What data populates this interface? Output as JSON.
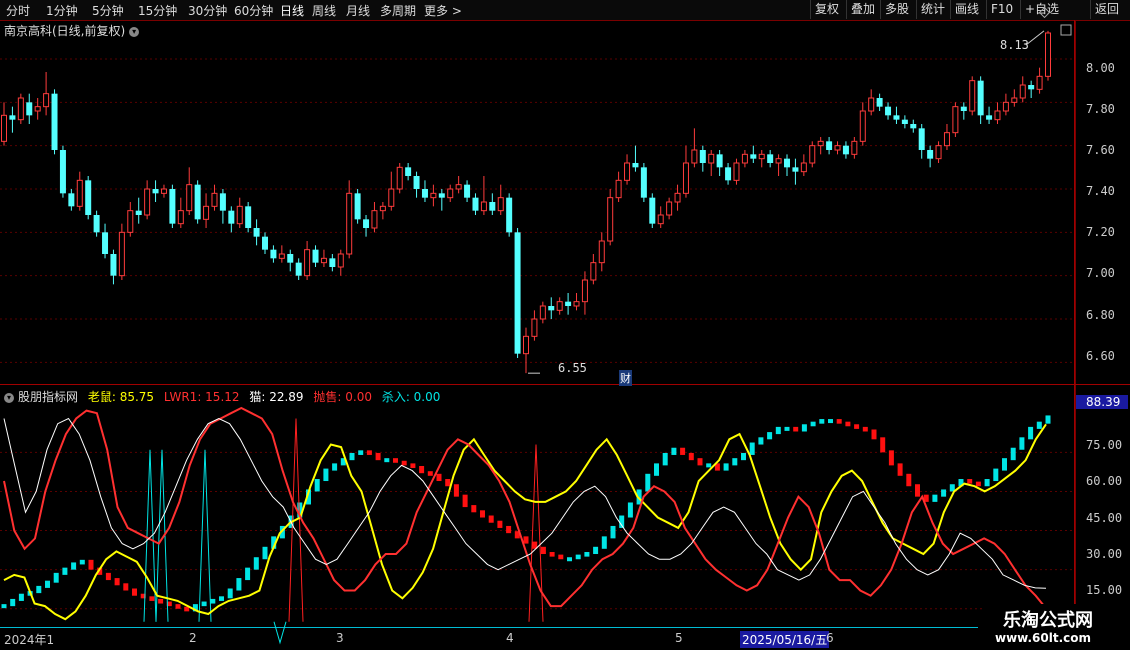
{
  "toolbar": {
    "timeframes": [
      "分时",
      "1分钟",
      "5分钟",
      "15分钟",
      "30分钟",
      "60分钟",
      "日线",
      "周线",
      "月线",
      "多周期",
      "更多 >"
    ],
    "active_timeframe": "日线",
    "right_buttons": [
      "复权",
      "叠加",
      "多股",
      "统计",
      "画线",
      "F10",
      "+自选",
      "返回"
    ]
  },
  "price_panel": {
    "title": "南京高科(日线,前复权)",
    "axis_ticks": [
      "8.00",
      "7.80",
      "7.60",
      "7.40",
      "7.20",
      "7.00",
      "6.80",
      "6.60"
    ],
    "high_marker": "8.13",
    "low_marker": "6.55",
    "finance_badge": "财",
    "ylim": [
      6.5,
      8.18
    ]
  },
  "indicator_panel": {
    "name": "股朋指标网",
    "labels": [
      {
        "text": "老鼠: 85.75",
        "color": "#ffff00"
      },
      {
        "text": "LWR1: 15.12",
        "color": "#ff3030"
      },
      {
        "text": "猫: 22.89",
        "color": "#ffffff"
      },
      {
        "text": "抛售: 0.00",
        "color": "#ff3030"
      },
      {
        "text": "杀入: 0.00",
        "color": "#00e5e5"
      }
    ],
    "axis_ticks": [
      "75.00",
      "60.00",
      "45.00",
      "30.00",
      "15.00"
    ],
    "current_value": "88.39",
    "ylim": [
      8,
      97
    ]
  },
  "time_axis": {
    "labels": [
      "2024年1",
      "2",
      "3",
      "4",
      "5",
      "2025/05/16/五",
      "6"
    ],
    "selected": "2025/05/16/五"
  },
  "watermark": {
    "line1": "乐淘公式网",
    "line2": "www.60lt.com"
  },
  "chart_data": [
    {
      "type": "candlestick",
      "title": "南京高科(日线,前复权)",
      "ylim": [
        6.5,
        8.18
      ],
      "candles": [
        [
          7.62,
          7.74,
          7.8,
          7.6
        ],
        [
          7.74,
          7.72,
          7.78,
          7.66
        ],
        [
          7.72,
          7.82,
          7.84,
          7.7
        ],
        [
          7.8,
          7.74,
          7.84,
          7.7
        ],
        [
          7.76,
          7.78,
          7.82,
          7.72
        ],
        [
          7.78,
          7.84,
          7.94,
          7.74
        ],
        [
          7.84,
          7.58,
          7.86,
          7.56
        ],
        [
          7.58,
          7.38,
          7.6,
          7.36
        ],
        [
          7.38,
          7.32,
          7.4,
          7.3
        ],
        [
          7.32,
          7.44,
          7.48,
          7.3
        ],
        [
          7.44,
          7.28,
          7.46,
          7.26
        ],
        [
          7.28,
          7.2,
          7.3,
          7.18
        ],
        [
          7.2,
          7.1,
          7.24,
          7.08
        ],
        [
          7.1,
          7.0,
          7.12,
          6.96
        ],
        [
          7.0,
          7.2,
          7.24,
          6.98
        ],
        [
          7.2,
          7.3,
          7.34,
          7.18
        ],
        [
          7.3,
          7.28,
          7.36,
          7.24
        ],
        [
          7.28,
          7.4,
          7.44,
          7.26
        ],
        [
          7.4,
          7.38,
          7.44,
          7.34
        ],
        [
          7.38,
          7.4,
          7.42,
          7.36
        ],
        [
          7.4,
          7.24,
          7.42,
          7.22
        ],
        [
          7.24,
          7.3,
          7.36,
          7.22
        ],
        [
          7.3,
          7.42,
          7.5,
          7.28
        ],
        [
          7.42,
          7.26,
          7.44,
          7.24
        ],
        [
          7.26,
          7.32,
          7.38,
          7.22
        ],
        [
          7.32,
          7.38,
          7.42,
          7.3
        ],
        [
          7.38,
          7.3,
          7.4,
          7.24
        ],
        [
          7.3,
          7.24,
          7.32,
          7.2
        ],
        [
          7.24,
          7.32,
          7.36,
          7.22
        ],
        [
          7.32,
          7.22,
          7.34,
          7.2
        ],
        [
          7.22,
          7.18,
          7.26,
          7.14
        ],
        [
          7.18,
          7.12,
          7.2,
          7.1
        ],
        [
          7.12,
          7.08,
          7.14,
          7.06
        ],
        [
          7.08,
          7.1,
          7.14,
          7.06
        ],
        [
          7.1,
          7.06,
          7.12,
          7.02
        ],
        [
          7.06,
          7.0,
          7.08,
          6.98
        ],
        [
          7.0,
          7.12,
          7.16,
          6.98
        ],
        [
          7.12,
          7.06,
          7.14,
          7.04
        ],
        [
          7.06,
          7.08,
          7.12,
          7.04
        ],
        [
          7.08,
          7.04,
          7.1,
          7.02
        ],
        [
          7.04,
          7.1,
          7.12,
          7.0
        ],
        [
          7.1,
          7.38,
          7.44,
          7.08
        ],
        [
          7.38,
          7.26,
          7.4,
          7.24
        ],
        [
          7.26,
          7.22,
          7.28,
          7.18
        ],
        [
          7.22,
          7.3,
          7.34,
          7.2
        ],
        [
          7.3,
          7.32,
          7.34,
          7.26
        ],
        [
          7.32,
          7.4,
          7.48,
          7.3
        ],
        [
          7.4,
          7.5,
          7.52,
          7.38
        ],
        [
          7.5,
          7.46,
          7.52,
          7.44
        ],
        [
          7.46,
          7.4,
          7.48,
          7.36
        ],
        [
          7.4,
          7.36,
          7.44,
          7.34
        ],
        [
          7.36,
          7.38,
          7.42,
          7.32
        ],
        [
          7.38,
          7.36,
          7.4,
          7.3
        ],
        [
          7.36,
          7.4,
          7.42,
          7.34
        ],
        [
          7.4,
          7.42,
          7.46,
          7.38
        ],
        [
          7.42,
          7.36,
          7.44,
          7.34
        ],
        [
          7.36,
          7.3,
          7.38,
          7.28
        ],
        [
          7.3,
          7.34,
          7.46,
          7.28
        ],
        [
          7.34,
          7.3,
          7.38,
          7.28
        ],
        [
          7.3,
          7.36,
          7.42,
          7.28
        ],
        [
          7.36,
          7.2,
          7.38,
          7.18
        ],
        [
          7.2,
          6.64,
          7.22,
          6.62
        ],
        [
          6.64,
          6.72,
          6.76,
          6.55
        ],
        [
          6.72,
          6.8,
          6.84,
          6.7
        ],
        [
          6.8,
          6.86,
          6.88,
          6.78
        ],
        [
          6.86,
          6.84,
          6.9,
          6.8
        ],
        [
          6.84,
          6.88,
          6.9,
          6.82
        ],
        [
          6.88,
          6.86,
          6.92,
          6.82
        ],
        [
          6.86,
          6.88,
          6.92,
          6.84
        ],
        [
          6.88,
          6.98,
          7.02,
          6.82
        ],
        [
          6.98,
          7.06,
          7.1,
          6.96
        ],
        [
          7.06,
          7.16,
          7.2,
          7.02
        ],
        [
          7.16,
          7.36,
          7.4,
          7.14
        ],
        [
          7.36,
          7.44,
          7.48,
          7.34
        ],
        [
          7.44,
          7.52,
          7.56,
          7.42
        ],
        [
          7.52,
          7.5,
          7.6,
          7.48
        ],
        [
          7.5,
          7.36,
          7.52,
          7.34
        ],
        [
          7.36,
          7.24,
          7.38,
          7.22
        ],
        [
          7.24,
          7.28,
          7.32,
          7.22
        ],
        [
          7.28,
          7.34,
          7.36,
          7.26
        ],
        [
          7.34,
          7.38,
          7.42,
          7.3
        ],
        [
          7.38,
          7.52,
          7.6,
          7.36
        ],
        [
          7.52,
          7.58,
          7.68,
          7.5
        ],
        [
          7.58,
          7.52,
          7.6,
          7.48
        ],
        [
          7.52,
          7.56,
          7.58,
          7.46
        ],
        [
          7.56,
          7.5,
          7.58,
          7.46
        ],
        [
          7.5,
          7.44,
          7.52,
          7.42
        ],
        [
          7.44,
          7.52,
          7.54,
          7.42
        ],
        [
          7.52,
          7.56,
          7.58,
          7.5
        ],
        [
          7.56,
          7.54,
          7.6,
          7.52
        ],
        [
          7.54,
          7.56,
          7.58,
          7.5
        ],
        [
          7.56,
          7.52,
          7.58,
          7.5
        ],
        [
          7.52,
          7.54,
          7.56,
          7.46
        ],
        [
          7.54,
          7.5,
          7.56,
          7.46
        ],
        [
          7.5,
          7.48,
          7.54,
          7.42
        ],
        [
          7.48,
          7.52,
          7.56,
          7.46
        ],
        [
          7.52,
          7.6,
          7.62,
          7.5
        ],
        [
          7.6,
          7.62,
          7.64,
          7.56
        ],
        [
          7.62,
          7.58,
          7.64,
          7.56
        ],
        [
          7.58,
          7.6,
          7.62,
          7.56
        ],
        [
          7.6,
          7.56,
          7.62,
          7.54
        ],
        [
          7.56,
          7.62,
          7.64,
          7.54
        ],
        [
          7.62,
          7.76,
          7.8,
          7.6
        ],
        [
          7.76,
          7.82,
          7.86,
          7.74
        ],
        [
          7.82,
          7.78,
          7.84,
          7.76
        ],
        [
          7.78,
          7.74,
          7.8,
          7.72
        ],
        [
          7.74,
          7.72,
          7.78,
          7.7
        ],
        [
          7.72,
          7.7,
          7.74,
          7.68
        ],
        [
          7.7,
          7.68,
          7.72,
          7.66
        ],
        [
          7.68,
          7.58,
          7.7,
          7.54
        ],
        [
          7.58,
          7.54,
          7.6,
          7.5
        ],
        [
          7.54,
          7.6,
          7.62,
          7.52
        ],
        [
          7.6,
          7.66,
          7.7,
          7.58
        ],
        [
          7.66,
          7.78,
          7.8,
          7.64
        ],
        [
          7.78,
          7.76,
          7.8,
          7.72
        ],
        [
          7.76,
          7.9,
          7.92,
          7.74
        ],
        [
          7.9,
          7.74,
          7.92,
          7.7
        ],
        [
          7.74,
          7.72,
          7.78,
          7.7
        ],
        [
          7.72,
          7.76,
          7.8,
          7.7
        ],
        [
          7.76,
          7.8,
          7.84,
          7.74
        ],
        [
          7.8,
          7.82,
          7.86,
          7.78
        ],
        [
          7.82,
          7.88,
          7.92,
          7.8
        ],
        [
          7.88,
          7.86,
          7.9,
          7.82
        ],
        [
          7.86,
          7.92,
          7.96,
          7.84
        ],
        [
          7.92,
          8.12,
          8.13,
          7.9
        ]
      ]
    },
    {
      "type": "line",
      "title": "股朋指标网",
      "ylim": [
        8,
        97
      ],
      "x_labels": [
        "2024年1",
        "2",
        "3",
        "4",
        "5",
        "6"
      ],
      "series": [
        {
          "name": "老鼠",
          "color": "#ffff00",
          "values": [
            26,
            28,
            27,
            17,
            16,
            13,
            11,
            14,
            20,
            28,
            34,
            37,
            35,
            33,
            27,
            20,
            19,
            18,
            16,
            14,
            13,
            16,
            18,
            19,
            20,
            22,
            35,
            44,
            48,
            50,
            62,
            72,
            78,
            77,
            66,
            60,
            46,
            32,
            22,
            19,
            23,
            29,
            38,
            52,
            66,
            76,
            80,
            74,
            68,
            64,
            60,
            57,
            56,
            56,
            58,
            60,
            64,
            70,
            76,
            80,
            74,
            66,
            58,
            54,
            50,
            48,
            46,
            52,
            64,
            68,
            72,
            80,
            82,
            74,
            62,
            50,
            40,
            34,
            30,
            34,
            52,
            60,
            66,
            68,
            64,
            56,
            48,
            42,
            40,
            38,
            36,
            40,
            52,
            60,
            63,
            62,
            60,
            62,
            65,
            68,
            72,
            80,
            85.75
          ]
        },
        {
          "name": "LWR1",
          "color": "#ff3030",
          "values": [
            64,
            45,
            38,
            42,
            60,
            72,
            82,
            88,
            91,
            90,
            76,
            54,
            46,
            44,
            42,
            40,
            46,
            56,
            70,
            80,
            86,
            88,
            90,
            92,
            90,
            88,
            82,
            68,
            56,
            48,
            42,
            34,
            26,
            22,
            22,
            26,
            32,
            36,
            36,
            40,
            52,
            60,
            68,
            76,
            80,
            78,
            74,
            70,
            64,
            56,
            44,
            32,
            22,
            16,
            16,
            20,
            24,
            30,
            34,
            36,
            40,
            46,
            58,
            62,
            60,
            56,
            46,
            40,
            34,
            30,
            27,
            24,
            22,
            24,
            30,
            40,
            50,
            58,
            54,
            44,
            30,
            26,
            26,
            22,
            20,
            24,
            30,
            40,
            52,
            58,
            48,
            40,
            36,
            38,
            40,
            42,
            40,
            36,
            30,
            24,
            20,
            15.12
          ]
        },
        {
          "name": "猫",
          "color": "#ffffff",
          "values": [
            88,
            70,
            52,
            60,
            76,
            86,
            88,
            82,
            72,
            58,
            46,
            40,
            38,
            40,
            44,
            52,
            62,
            72,
            80,
            86,
            88,
            86,
            80,
            72,
            64,
            58,
            54,
            46,
            40,
            34,
            32,
            34,
            40,
            46,
            52,
            60,
            66,
            70,
            68,
            64,
            58,
            52,
            46,
            40,
            36,
            32,
            30,
            32,
            34,
            36,
            40,
            44,
            50,
            56,
            60,
            62,
            58,
            50,
            44,
            40,
            36,
            34,
            34,
            36,
            40,
            46,
            52,
            54,
            52,
            46,
            40,
            36,
            30,
            28,
            26,
            28,
            34,
            42,
            50,
            58,
            60,
            54,
            48,
            40,
            34,
            30,
            28,
            30,
            36,
            44,
            42,
            38,
            34,
            28,
            26,
            24,
            23,
            22.89
          ]
        }
      ],
      "bars": {
        "name": "老鼠",
        "bullish_color": "#00e5e5",
        "bearish_color": "#ff1010",
        "values": [
          16,
          18,
          20,
          21,
          23,
          25,
          28,
          30,
          32,
          33,
          30,
          28,
          26,
          24,
          22,
          20,
          19,
          18,
          17,
          16,
          15,
          14,
          16,
          17,
          18,
          19,
          22,
          26,
          30,
          34,
          38,
          42,
          46,
          50,
          55,
          60,
          64,
          68,
          70,
          72,
          74,
          75,
          74,
          72,
          72,
          71,
          70,
          69,
          67,
          66,
          64,
          62,
          58,
          54,
          52,
          50,
          48,
          46,
          44,
          42,
          40,
          38,
          36,
          35,
          34,
          34,
          35,
          36,
          38,
          42,
          46,
          50,
          55,
          60,
          66,
          70,
          74,
          76,
          74,
          72,
          70,
          70,
          68,
          70,
          72,
          74,
          78,
          80,
          82,
          84,
          84,
          83,
          85,
          86,
          87,
          87,
          86,
          85,
          84,
          83,
          80,
          75,
          70,
          66,
          62,
          58,
          56,
          58,
          60,
          62,
          64,
          63,
          62,
          64,
          68,
          72,
          76,
          80,
          84,
          86,
          88.39
        ]
      },
      "spikes": {
        "cyan": [
          [
            150,
            76
          ],
          [
            162,
            76
          ],
          [
            205,
            76
          ],
          [
            280,
            2
          ]
        ],
        "red": [
          [
            296,
            88
          ],
          [
            536,
            78
          ]
        ]
      }
    }
  ]
}
